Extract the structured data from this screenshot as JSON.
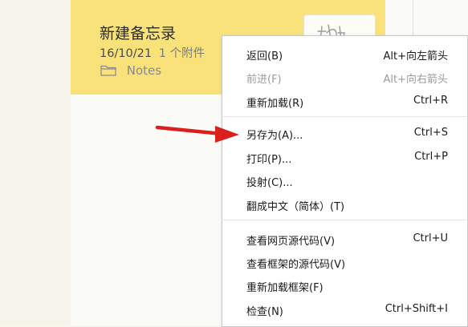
{
  "note": {
    "title": "新建备忘录",
    "date": "16/10/21",
    "attachments": "1 个附件",
    "folder": "Notes"
  },
  "menu": {
    "items": [
      {
        "label": "返回(B)",
        "shortcut": "Alt+向左箭头",
        "enabled": true
      },
      {
        "label": "前进(F)",
        "shortcut": "Alt+向右箭头",
        "enabled": false
      },
      {
        "label": "重新加载(R)",
        "shortcut": "Ctrl+R",
        "enabled": true
      },
      {
        "label": "另存为(A)...",
        "shortcut": "Ctrl+S",
        "enabled": true
      },
      {
        "label": "打印(P)...",
        "shortcut": "Ctrl+P",
        "enabled": true
      },
      {
        "label": "投射(C)...",
        "shortcut": "",
        "enabled": true
      },
      {
        "label": "翻成中文（简体）(T)",
        "shortcut": "",
        "enabled": true
      },
      {
        "label": "查看网页源代码(V)",
        "shortcut": "Ctrl+U",
        "enabled": true
      },
      {
        "label": "查看框架的源代码(V)",
        "shortcut": "",
        "enabled": true
      },
      {
        "label": "重新加载框架(F)",
        "shortcut": "",
        "enabled": true
      },
      {
        "label": "检查(N)",
        "shortcut": "Ctrl+Shift+I",
        "enabled": true
      }
    ]
  },
  "colors": {
    "note_highlight": "#f9e27a",
    "arrow": "#d9201c"
  },
  "icons": {
    "folder": "folder-icon",
    "thumbnail": "handwriting-thumbnail-icon",
    "arrow": "red-arrow-icon"
  }
}
